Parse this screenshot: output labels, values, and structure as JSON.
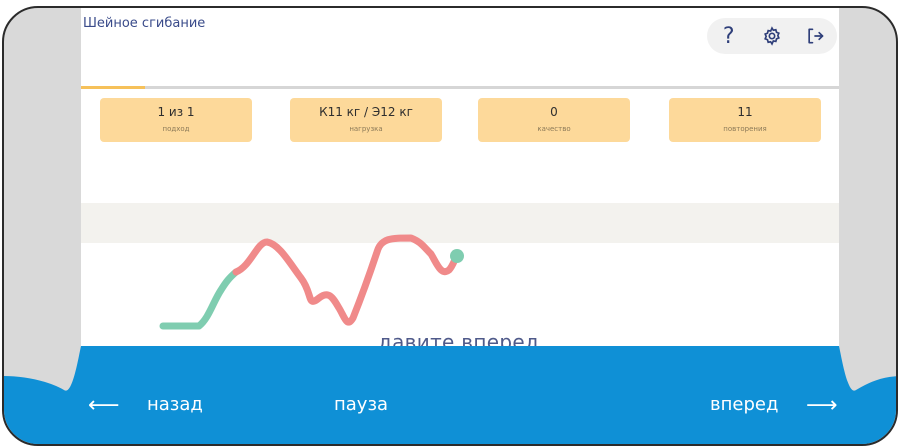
{
  "header": {
    "title": "Шейное сгибание",
    "help_icon": "question-icon",
    "settings_icon": "gear-icon",
    "exit_icon": "exit-icon"
  },
  "progress": {
    "fraction": 0.085,
    "color": "#f6c15a"
  },
  "stats": [
    {
      "value": "1 из 1",
      "label": "подход"
    },
    {
      "value": "К11 кг / Э12 кг",
      "label": "нагрузка"
    },
    {
      "value": "0",
      "label": "качество"
    },
    {
      "value": "11",
      "label": "повторения"
    }
  ],
  "graph": {
    "good_color": "#7fcdb0",
    "bad_color": "#f08a8a",
    "marker_color": "#7fcdb0"
  },
  "hint": "давите вперед",
  "footer": {
    "back_label": "назад",
    "pause_label": "пауза",
    "forward_label": "вперед",
    "bar_color": "#0f90d6"
  }
}
